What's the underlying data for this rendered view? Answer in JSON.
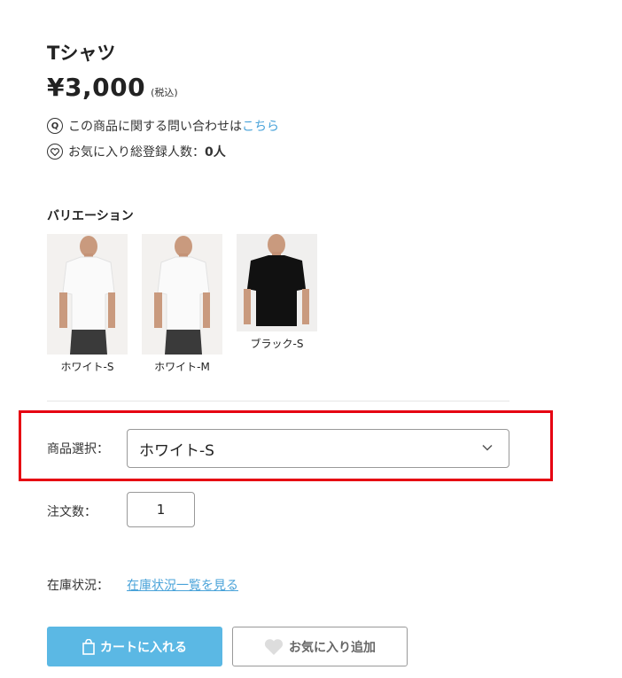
{
  "product": {
    "title": "Tシャツ",
    "price": "¥3,000",
    "tax_note": "(税込)"
  },
  "inquiry": {
    "icon": "question-icon",
    "text": "この商品に関する問い合わせは",
    "link": "こちら"
  },
  "favorites": {
    "icon": "heart-icon",
    "label": "お気に入り総登録人数：",
    "count": "0人"
  },
  "variations": {
    "title": "バリエーション",
    "items": [
      {
        "label": "ホワイト-S",
        "color": "#ffffff"
      },
      {
        "label": "ホワイト-M",
        "color": "#ffffff"
      },
      {
        "label": "ブラック-S",
        "color": "#111111"
      }
    ]
  },
  "selection": {
    "label": "商品選択：",
    "value": "ホワイト-S"
  },
  "quantity": {
    "label": "注文数：",
    "value": "1"
  },
  "stock": {
    "label": "在庫状況：",
    "link": "在庫状況一覧を見る"
  },
  "buttons": {
    "cart": "カートに入れる",
    "favorite": "お気に入り追加"
  },
  "colors": {
    "accent": "#5bb8e4",
    "link": "#4aa3d9",
    "highlight": "#e60012"
  }
}
